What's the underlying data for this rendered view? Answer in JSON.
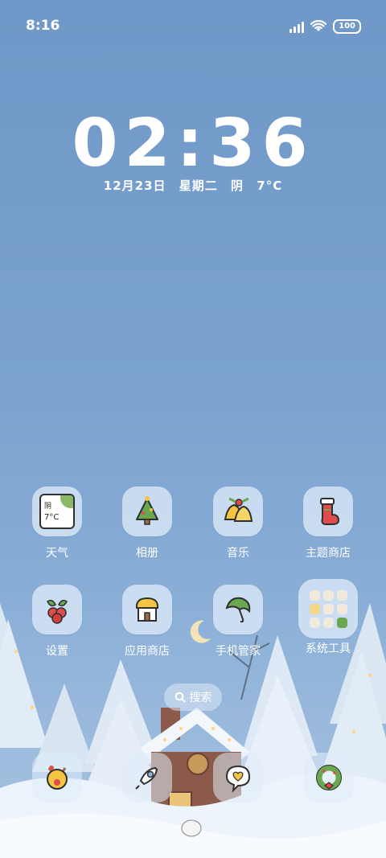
{
  "status_bar": {
    "time": "8:16",
    "battery": "100"
  },
  "clock": {
    "time": "02:36"
  },
  "date": {
    "day": "12月23日",
    "weekday": "星期二",
    "weather": "阴",
    "temp": "7°C"
  },
  "weather_icon": {
    "condition": "阴",
    "temp": "7°C"
  },
  "apps_row1": [
    {
      "label": "天气"
    },
    {
      "label": "相册"
    },
    {
      "label": "音乐"
    },
    {
      "label": "主题商店"
    }
  ],
  "apps_row2": [
    {
      "label": "设置"
    },
    {
      "label": "应用商店"
    },
    {
      "label": "手机管家"
    },
    {
      "label": "系统工具"
    }
  ],
  "search": {
    "label": "搜索"
  },
  "colors": {
    "sky": "#7ba2cf",
    "snow": "#eef4fb",
    "tree": "#dfe9f5",
    "house": "#8b5a4a"
  }
}
